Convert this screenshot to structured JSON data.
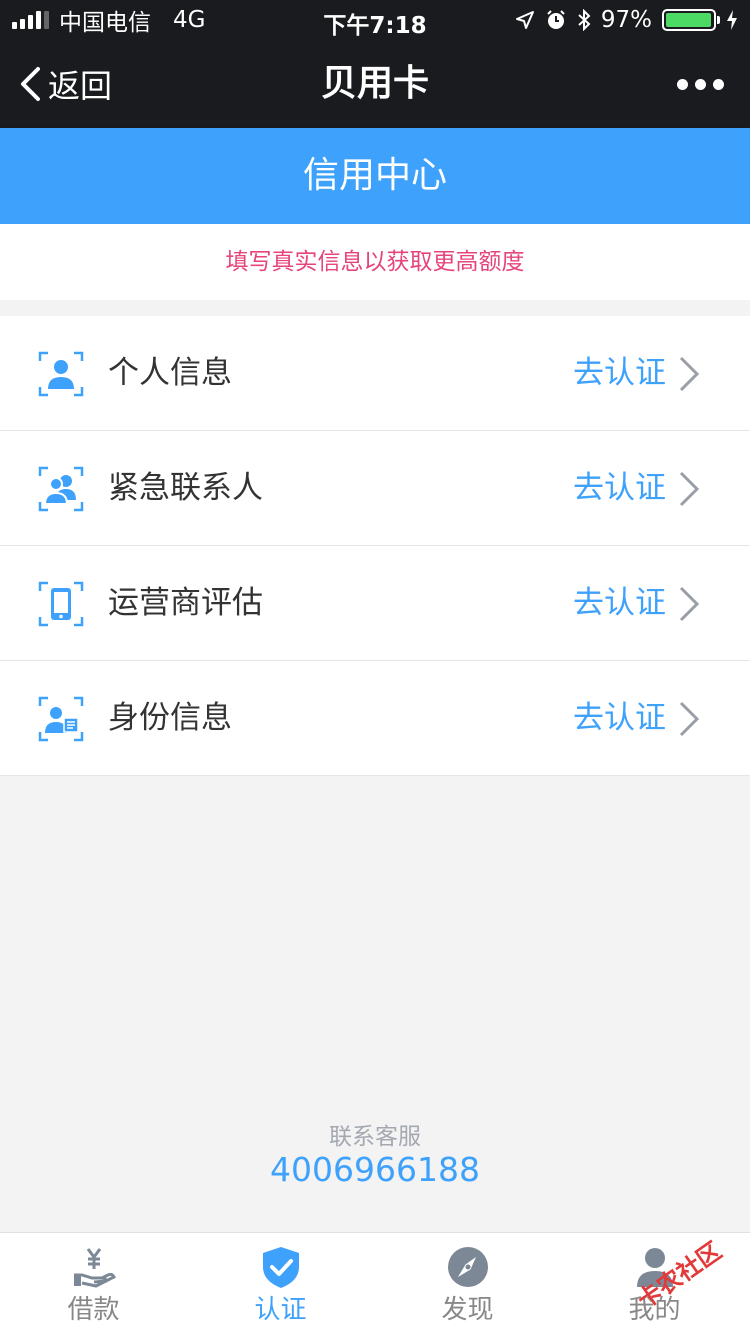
{
  "status_bar": {
    "carrier": "中国电信",
    "network": "4G",
    "time": "下午7:18",
    "battery": "97%"
  },
  "nav": {
    "back_label": "返回",
    "title": "贝用卡"
  },
  "banner": {
    "title": "信用中心"
  },
  "tip": "填写真实信息以获取更高额度",
  "items": [
    {
      "label": "个人信息",
      "action": "去认证",
      "icon": "person-card-icon"
    },
    {
      "label": "紧急联系人",
      "action": "去认证",
      "icon": "contacts-icon"
    },
    {
      "label": "运营商评估",
      "action": "去认证",
      "icon": "phone-icon"
    },
    {
      "label": "身份信息",
      "action": "去认证",
      "icon": "id-card-icon"
    }
  ],
  "contact": {
    "label": "联系客服",
    "phone": "4006966188"
  },
  "tabs": [
    {
      "label": "借款",
      "icon": "loan-icon",
      "active": false
    },
    {
      "label": "认证",
      "icon": "shield-check-icon",
      "active": true
    },
    {
      "label": "发现",
      "icon": "compass-icon",
      "active": false
    },
    {
      "label": "我的",
      "icon": "user-icon",
      "active": false
    }
  ],
  "watermark": "卡农社区",
  "colors": {
    "accent": "#3ea1fb",
    "tip": "#e6457a",
    "dark_bar": "#1a1b1e"
  }
}
